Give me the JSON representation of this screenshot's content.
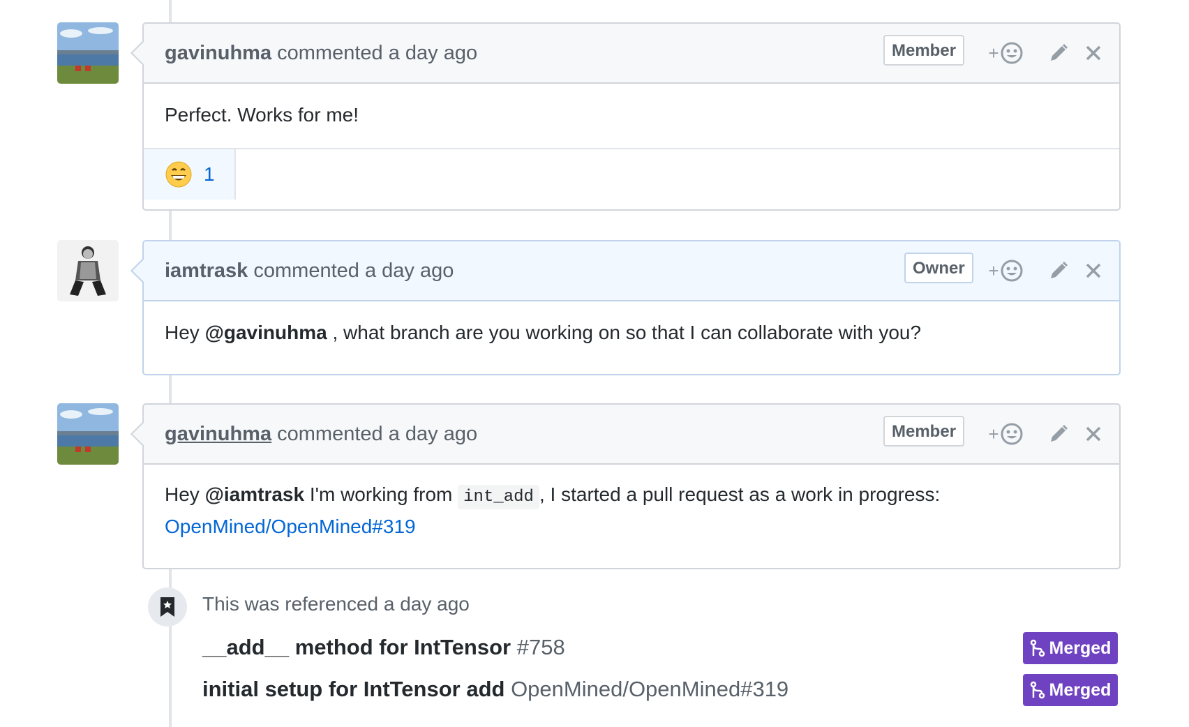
{
  "comments": [
    {
      "author": "gavinuhma",
      "meta": " commented a day ago",
      "badge": "Member",
      "body": "Perfect. Works for me!",
      "reaction": {
        "emoji": "grinning-face",
        "count": "1"
      }
    },
    {
      "author": "iamtrask",
      "meta": " commented a day ago",
      "badge": "Owner",
      "body_prefix": "Hey ",
      "mention": "@gavinuhma",
      "body_suffix": " , what branch are you working on so that I can collaborate with you?"
    },
    {
      "author": "gavinuhma",
      "meta": " commented a day ago",
      "badge": "Member",
      "body_prefix": "Hey ",
      "mention": "@iamtrask",
      "body_mid": " I'm working from ",
      "code": "int_add",
      "body_suffix": ", I started a pull request as a work in progress:",
      "link": "OpenMined/OpenMined#319"
    }
  ],
  "actions": {
    "add_reaction": "+",
    "icons": [
      "add-reaction-icon",
      "pencil-icon",
      "close-icon"
    ]
  },
  "reference": {
    "text": "This was referenced a day ago",
    "items": [
      {
        "title": "__add__ method for IntTensor",
        "number": " #758",
        "status": "Merged"
      },
      {
        "title": "initial setup for IntTensor add",
        "number": " OpenMined/OpenMined#319",
        "status": "Merged"
      }
    ]
  },
  "colors": {
    "merged": "#6f42c1",
    "link": "#0366d6",
    "owner_header": "#f1f8ff"
  }
}
